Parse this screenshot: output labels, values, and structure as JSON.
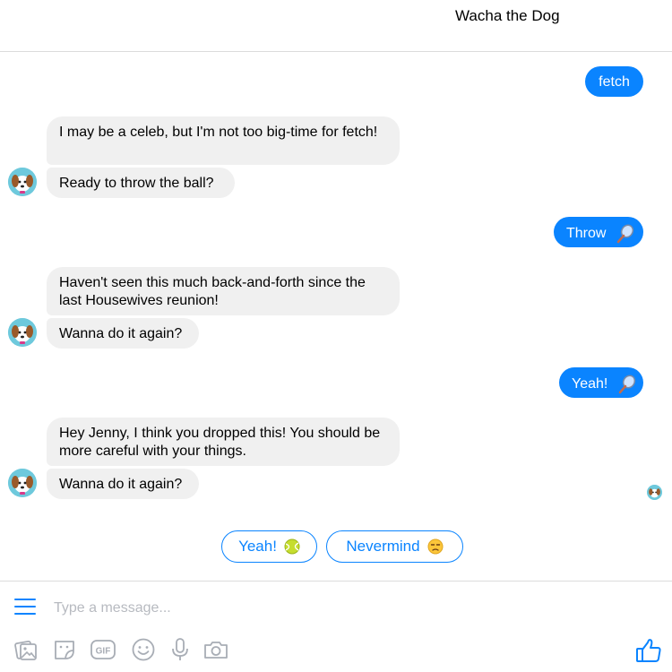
{
  "header": {
    "title": "Wacha the Dog"
  },
  "messages": {
    "m1": "fetch",
    "m2": "I may be a celeb, but I'm not too big-time for fetch!",
    "m3": "Ready to throw the ball?",
    "m4": "Throw",
    "m5": "Haven't seen this much back-and-forth since the last Housewives reunion!",
    "m6": "Wanna do it again?",
    "m7": "Yeah!",
    "m8": "Hey Jenny, I think you dropped this! You should be more careful with your things.",
    "m9": "Wanna do it again?"
  },
  "quick_replies": {
    "yeah": "Yeah!",
    "nevermind": "Nevermind"
  },
  "composer": {
    "placeholder": "Type a message..."
  },
  "colors": {
    "accent": "#0a84ff",
    "incoming_bubble": "#f0f0f0",
    "icon_gray": "#a8adb5"
  },
  "icons": [
    "menu-icon",
    "photo-icon",
    "sticker-icon",
    "gif-icon",
    "emoji-icon",
    "microphone-icon",
    "camera-icon",
    "thumbs-up-icon",
    "tennis-racquet-icon",
    "tennis-ball-icon",
    "unamused-face-icon",
    "dog-avatar-icon"
  ]
}
